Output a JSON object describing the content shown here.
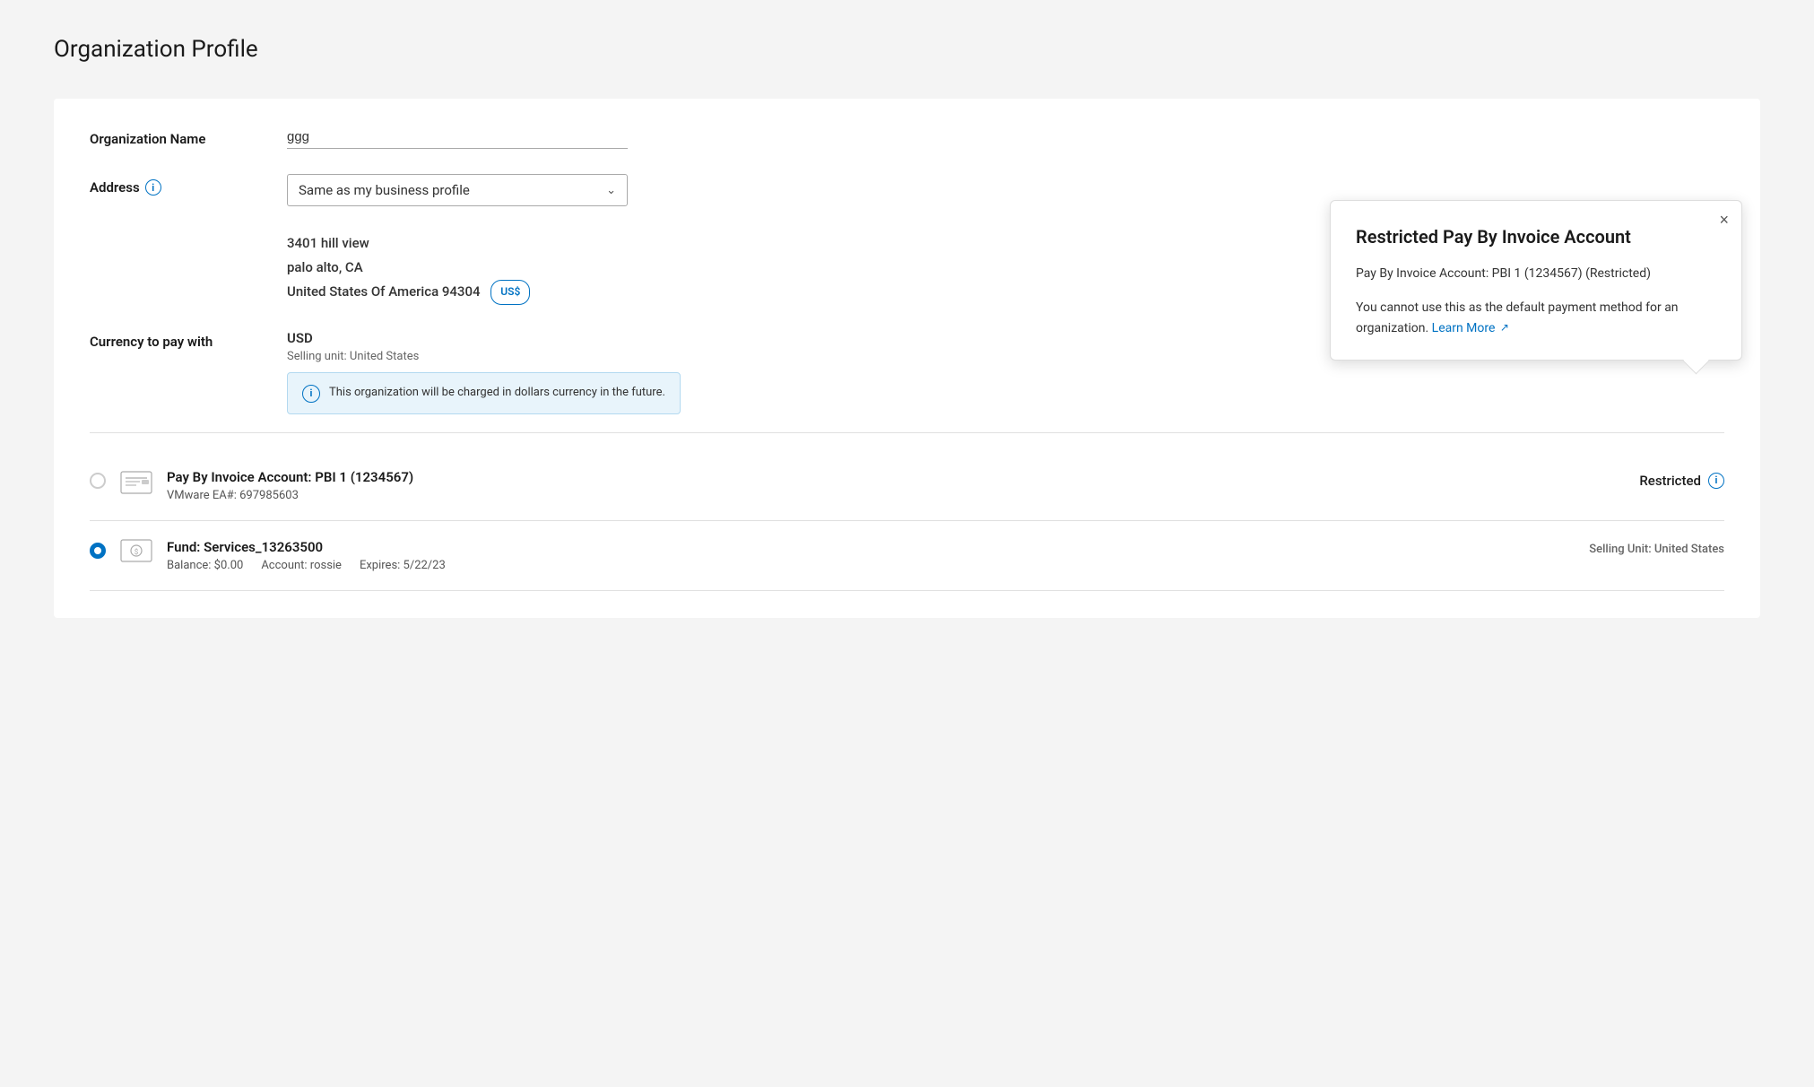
{
  "page": {
    "title": "Organization Profile"
  },
  "form": {
    "org_name_label": "Organization Name",
    "org_name_value": "ggg",
    "address_label": "Address",
    "address_dropdown": "Same as my business profile",
    "address_line1": "3401 hill view",
    "address_line2": "palo alto, CA",
    "address_line3": "United States Of America 94304",
    "currency_badge": "US$",
    "currency_label": "Currency to pay with",
    "currency_value": "USD",
    "selling_unit": "Selling unit: United States",
    "info_text": "This organization will be charged in dollars currency in the future."
  },
  "popup": {
    "title": "Restricted Pay By Invoice Account",
    "account_detail": "Pay By Invoice Account: PBI 1 (1234567) (Restricted)",
    "description": "You cannot use this as the default payment method for an organization.",
    "learn_more": "Learn More",
    "close_label": "×"
  },
  "payment_methods": [
    {
      "id": "pbi",
      "name": "Pay By Invoice Account: PBI 1 (1234567)",
      "sub": "VMware EA#: 697985603",
      "status": "Restricted",
      "selected": false,
      "type": "invoice"
    },
    {
      "id": "fund",
      "name": "Fund: Services_13263500",
      "balance": "Balance: $0.00",
      "account": "Account: rossie",
      "expires": "Expires: 5/22/23",
      "selling_unit": "Selling Unit: United States",
      "selected": true,
      "type": "fund"
    }
  ]
}
